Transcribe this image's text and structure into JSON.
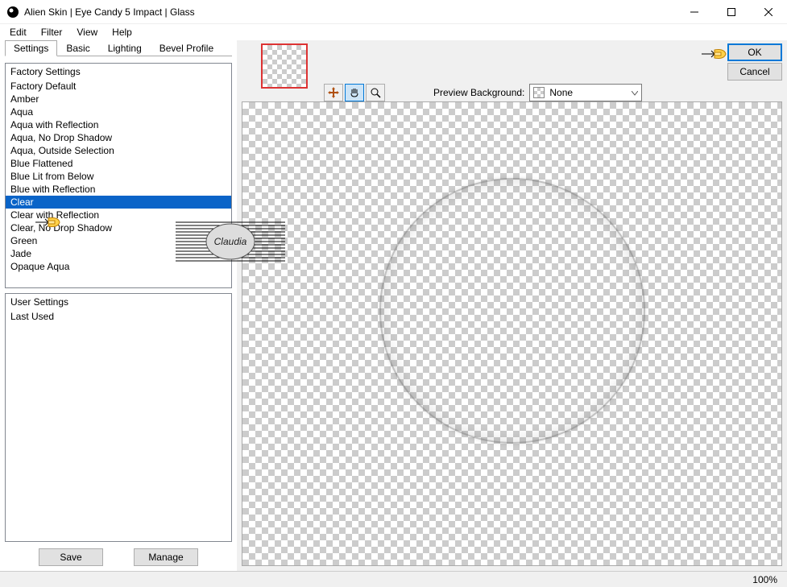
{
  "window_title": "Alien Skin | Eye Candy 5 Impact | Glass",
  "menus": [
    "Edit",
    "Filter",
    "View",
    "Help"
  ],
  "tabs": [
    {
      "label": "Settings",
      "active": true
    },
    {
      "label": "Basic",
      "active": false
    },
    {
      "label": "Lighting",
      "active": false
    },
    {
      "label": "Bevel Profile",
      "active": false
    }
  ],
  "factory_heading": "Factory Settings",
  "factory_items": [
    "Factory Default",
    "Amber",
    "Aqua",
    "Aqua with Reflection",
    "Aqua, No Drop Shadow",
    "Aqua, Outside Selection",
    "Blue Flattened",
    "Blue Lit from Below",
    "Blue with Reflection",
    "Clear",
    "Clear with Reflection",
    "Clear, No Drop Shadow",
    "Green",
    "Jade",
    "Opaque Aqua"
  ],
  "factory_selected": "Clear",
  "user_heading": "User Settings",
  "user_items": [
    "Last Used"
  ],
  "save_btn": "Save",
  "manage_btn": "Manage",
  "preview_bg_label": "Preview Background:",
  "preview_bg_value": "None",
  "ok_btn": "OK",
  "cancel_btn": "Cancel",
  "zoom_label": "100%",
  "watermark_text": "Claudia"
}
